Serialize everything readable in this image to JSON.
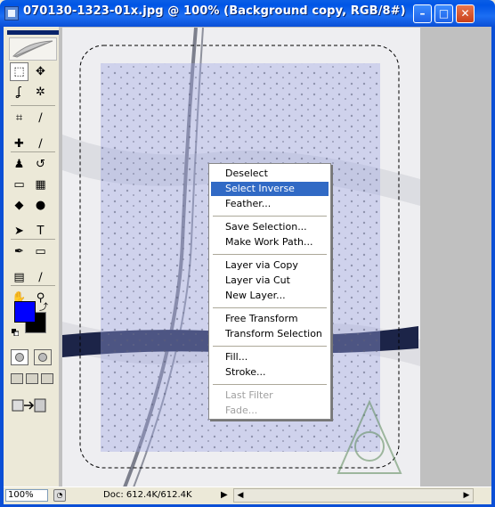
{
  "window": {
    "title": "070130-1323-01x.jpg @ 100% (Background copy, RGB/8#)",
    "buttons": {
      "minimize": "–",
      "maximize": "□",
      "close": "✕"
    }
  },
  "toolbox": {
    "tools": [
      {
        "name": "marquee-tool",
        "glyph": "⬚"
      },
      {
        "name": "move-tool",
        "glyph": "✥"
      },
      {
        "name": "lasso-tool",
        "glyph": "ʆ"
      },
      {
        "name": "magic-wand-tool",
        "glyph": "✲"
      },
      {
        "name": "crop-tool",
        "glyph": "⌗"
      },
      {
        "name": "slice-tool",
        "glyph": "∕"
      },
      {
        "name": "healing-brush-tool",
        "glyph": "✚"
      },
      {
        "name": "brush-tool",
        "glyph": "∕"
      },
      {
        "name": "clone-stamp-tool",
        "glyph": "♟"
      },
      {
        "name": "history-brush-tool",
        "glyph": "↺"
      },
      {
        "name": "eraser-tool",
        "glyph": "▭"
      },
      {
        "name": "gradient-tool",
        "glyph": "▦"
      },
      {
        "name": "blur-tool",
        "glyph": "◆"
      },
      {
        "name": "dodge-tool",
        "glyph": "●"
      },
      {
        "name": "path-selection-tool",
        "glyph": "➤"
      },
      {
        "name": "type-tool",
        "glyph": "T"
      },
      {
        "name": "pen-tool",
        "glyph": "✒"
      },
      {
        "name": "shape-tool",
        "glyph": "▭"
      },
      {
        "name": "notes-tool",
        "glyph": "▤"
      },
      {
        "name": "eyedropper-tool",
        "glyph": "∕"
      },
      {
        "name": "hand-tool",
        "glyph": "✋"
      },
      {
        "name": "zoom-tool",
        "glyph": "⚲"
      }
    ],
    "foreground_color": "#0000ff",
    "background_color": "#000000"
  },
  "status": {
    "zoom": "100%",
    "doc": "Doc: 612.4K/612.4K"
  },
  "context_menu": {
    "items": [
      {
        "label": "Deselect",
        "state": "normal"
      },
      {
        "label": "Select Inverse",
        "state": "highlighted"
      },
      {
        "label": "Feather...",
        "state": "normal"
      },
      {
        "label": "Save Selection...",
        "state": "normal"
      },
      {
        "label": "Make Work Path...",
        "state": "normal"
      },
      {
        "label": "Layer via Copy",
        "state": "normal"
      },
      {
        "label": "Layer via Cut",
        "state": "normal"
      },
      {
        "label": "New Layer...",
        "state": "normal"
      },
      {
        "label": "Free Transform",
        "state": "normal"
      },
      {
        "label": "Transform Selection",
        "state": "normal"
      },
      {
        "label": "Fill...",
        "state": "normal"
      },
      {
        "label": "Stroke...",
        "state": "normal"
      },
      {
        "label": "Last Filter",
        "state": "disabled"
      },
      {
        "label": "Fade...",
        "state": "disabled"
      }
    ]
  }
}
